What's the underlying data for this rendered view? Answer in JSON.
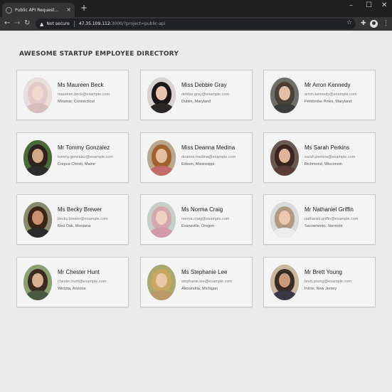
{
  "browser": {
    "tab_title": "Public API Request...",
    "tab_close": "×",
    "new_tab": "+",
    "window_controls": {
      "minimize": "–",
      "maximize": "☐",
      "close": "✕"
    },
    "nav": {
      "back": "←",
      "forward": "→",
      "reload": "↻"
    },
    "security_label": "Not secure",
    "url_host": "47.35.109.112",
    "url_path": ":3000/?project=public-api",
    "icons": [
      "warning-icon",
      "star-icon",
      "puzzle-icon",
      "profile-icon",
      "menu-icon"
    ]
  },
  "page": {
    "heading": "AWESOME STARTUP EMPLOYEE DIRECTORY"
  },
  "employees": [
    {
      "name": "Ms Maureen Beck",
      "email": "maureen.beck@example.com",
      "location": "Miramar, Connecticut",
      "colors": {
        "bg": "#e9dede",
        "hair": "#e3caca",
        "face": "#f2d9cf",
        "body": "#d8bcbc"
      }
    },
    {
      "name": "Miss Debbie Gray",
      "email": "debbie.gray@example.com",
      "location": "Dublin, Maryland",
      "colors": {
        "bg": "#d8d3d0",
        "hair": "#1b1717",
        "face": "#e8c5b0",
        "body": "#2b2626"
      }
    },
    {
      "name": "Mr Arron Kennedy",
      "email": "arron.kennedy@example.com",
      "location": "Pembroke Pines, Maryland",
      "colors": {
        "bg": "#6f6f6a",
        "hair": "#4a4038",
        "face": "#e3c0a8",
        "body": "#3d3d3d"
      }
    },
    {
      "name": "Mr Tommy Gonzalez",
      "email": "tommy.gonzalez@example.com",
      "location": "Corpus Christi, Maine",
      "colors": {
        "bg": "#4a6a3a",
        "hair": "#2e241d",
        "face": "#d0a88a",
        "body": "#2c2c2c"
      }
    },
    {
      "name": "Miss Deanna Medina",
      "email": "deanna.medina@example.com",
      "location": "Edison, Mississippi",
      "colors": {
        "bg": "#b8a890",
        "hair": "#a0622f",
        "face": "#e5bfa0",
        "body": "#c46a6a"
      }
    },
    {
      "name": "Ms Sarah Perkins",
      "email": "sarah.perkins@example.com",
      "location": "Richmond, Wisconsin",
      "colors": {
        "bg": "#6a5a54",
        "hair": "#3a2420",
        "face": "#e0b49a",
        "body": "#5a3c34"
      }
    },
    {
      "name": "Ms Becky Brewer",
      "email": "becky.brewer@example.com",
      "location": "Red Oak, Montana",
      "colors": {
        "bg": "#8a8a70",
        "hair": "#3a2515",
        "face": "#c89070",
        "body": "#2a2a2a"
      }
    },
    {
      "name": "Ms Norma Craig",
      "email": "norma.craig@example.com",
      "location": "Evansville, Oregon",
      "colors": {
        "bg": "#c8cec8",
        "hair": "#d4a6ad",
        "face": "#f0d0c0",
        "body": "#d098a8"
      }
    },
    {
      "name": "Mr Nathaniel Griffin",
      "email": "nathaniel.griffin@example.com",
      "location": "Sacramento, Vermont",
      "colors": {
        "bg": "#d8dcdc",
        "hair": "#b09a80",
        "face": "#ecc8b0",
        "body": "#ececec"
      }
    },
    {
      "name": "Mr Chester Hunt",
      "email": "chester.hunt@example.com",
      "location": "Wichita, Arizona",
      "colors": {
        "bg": "#8aa070",
        "hair": "#3a2a20",
        "face": "#d8b094",
        "body": "#4a5a40"
      }
    },
    {
      "name": "Ms Stephanie Lee",
      "email": "stephanie.lee@example.com",
      "location": "Alexandria, Michigan",
      "colors": {
        "bg": "#a8a870",
        "hair": "#c8a860",
        "face": "#eac8a8",
        "body": "#b89a68"
      }
    },
    {
      "name": "Mr Brett Young",
      "email": "brett.young@example.com",
      "location": "Irvine, New Jersey",
      "colors": {
        "bg": "#c8b8a0",
        "hair": "#3a2c22",
        "face": "#c89a7a",
        "body": "#3a3a46"
      }
    }
  ]
}
